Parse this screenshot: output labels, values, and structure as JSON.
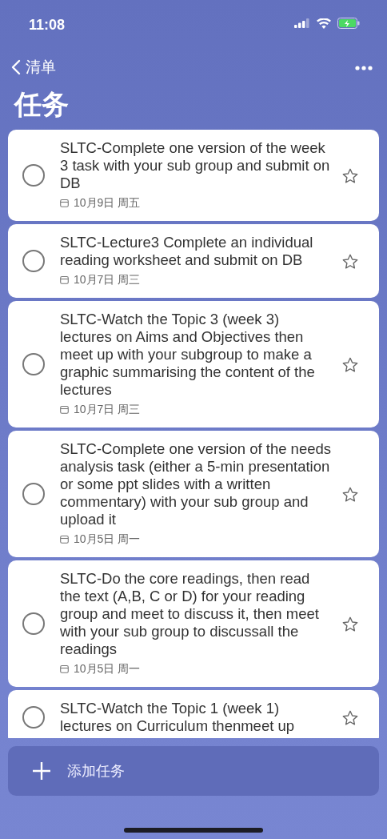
{
  "status_bar": {
    "time": "11:08"
  },
  "nav": {
    "back_label": "清单"
  },
  "title": "任务",
  "tasks": [
    {
      "title": "SLTC-Complete one version of the week 3 task with your sub group and submit on DB",
      "due": "10月9日 周五",
      "completed": false,
      "starred": false
    },
    {
      "title": "SLTC-Lecture3 Complete an individual reading worksheet and submit on DB",
      "due": "10月7日 周三",
      "completed": false,
      "starred": false
    },
    {
      "title": "SLTC-Watch the Topic 3 (week 3) lectures on Aims and Objectives then meet up with your subgroup to make a graphic summarising the content of the lectures",
      "due": "10月7日 周三",
      "completed": false,
      "starred": false
    },
    {
      "title": "SLTC-Complete one version of the needs analysis task (either a 5-min presentation or some ppt slides with a written commentary) with your sub group and upload it",
      "due": "10月5日 周一",
      "completed": false,
      "starred": false
    },
    {
      "title": "SLTC-Do the core readings, then read the text (A,B, C or D) for your reading group and meet to discuss it, then meet with your sub group to discussall the readings",
      "due": "10月5日 周一",
      "completed": false,
      "starred": false
    },
    {
      "title": "SLTC-Watch the Topic 1 (week 1) lectures on Curriculum thenmeet up",
      "completed": false,
      "starred": false
    }
  ],
  "add_task": {
    "label": "添加任务"
  }
}
